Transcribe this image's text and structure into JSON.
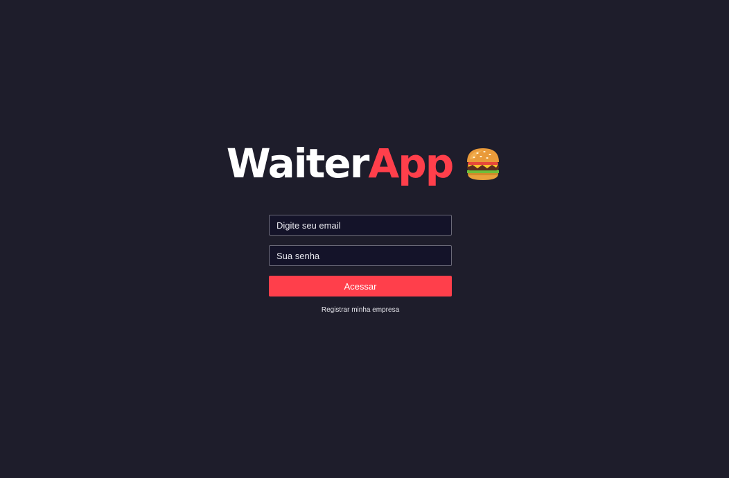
{
  "logo": {
    "part1": "Waiter",
    "part2": "App",
    "icon": "hamburger-emoji-icon"
  },
  "login_form": {
    "email_placeholder": "Digite seu email",
    "password_placeholder": "Sua senha",
    "submit_label": "Acessar",
    "register_link": "Registrar minha empresa"
  },
  "colors": {
    "background": "#1e1d2b",
    "accent": "#ff3f4b",
    "input_background": "#141329",
    "input_border": "#6b6a78"
  }
}
